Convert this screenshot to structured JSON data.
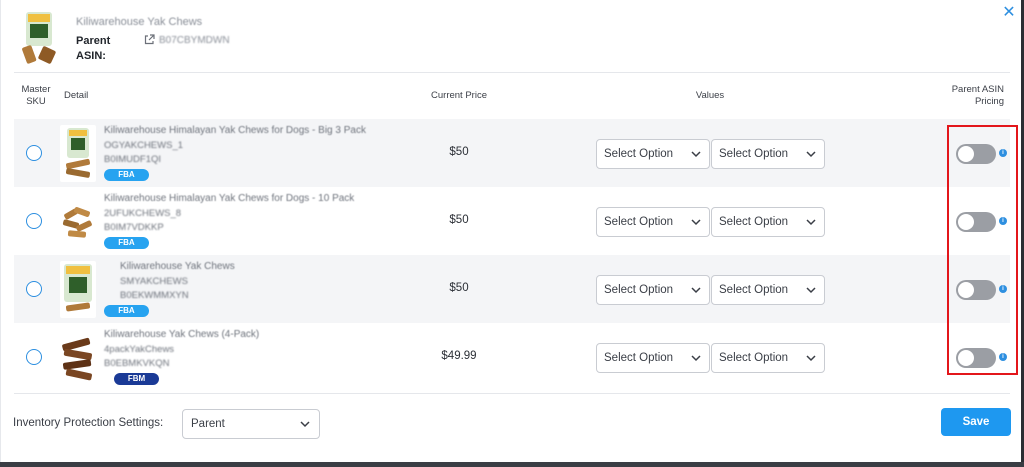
{
  "icons": {
    "close": "close-icon",
    "external_link": "external-link-icon",
    "chevron": "chevron-down-icon",
    "info": "info-icon"
  },
  "colors": {
    "accent": "#1e98f0",
    "fba_badge": "#27a3f0",
    "fbm_badge": "#1a3a96",
    "highlight": "#e3161b",
    "toggle_off": "#9b9ea4"
  },
  "header": {
    "product_title": "Kiliwarehouse Yak Chews",
    "parent_label_line1": "Parent",
    "parent_label_line2": "ASIN:",
    "parent_asin": "B07CBYMDWN"
  },
  "table": {
    "columns": {
      "master_line1": "Master",
      "master_line2": "SKU",
      "detail": "Detail",
      "current_price": "Current Price",
      "values": "Values",
      "pricing_line1": "Parent ASIN",
      "pricing_line2": "Pricing"
    },
    "rows": [
      {
        "name": "Kiliwarehouse Himalayan Yak Chews for Dogs - Big 3 Pack",
        "sku": "OGYAKCHEWS_1",
        "asin": "B0IMUDF1QI",
        "badge": "FBA",
        "price": "$50",
        "select1": "Select Option",
        "select2": "Select Option",
        "pricing_enabled": false
      },
      {
        "name": "Kiliwarehouse Himalayan Yak Chews for Dogs - 10 Pack",
        "sku": "2UFUKCHEWS_8",
        "asin": "B0IM7VDKKP",
        "badge": "FBA",
        "price": "$50",
        "select1": "Select Option",
        "select2": "Select Option",
        "pricing_enabled": false
      },
      {
        "name": "Kiliwarehouse Yak Chews",
        "sku": "SMYAKCHEWS",
        "asin": "B0EKWMMXYN",
        "badge": "FBA",
        "price": "$50",
        "select1": "Select Option",
        "select2": "Select Option",
        "pricing_enabled": false
      },
      {
        "name": "Kiliwarehouse Yak Chews (4-Pack)",
        "sku": "4packYakChews",
        "asin": "B0EBMKVKQN",
        "badge": "FBM",
        "price": "$49.99",
        "select1": "Select Option",
        "select2": "Select Option",
        "pricing_enabled": false
      }
    ]
  },
  "footer": {
    "protection_label": "Inventory Protection Settings:",
    "protection_value": "Parent",
    "save_label": "Save"
  }
}
